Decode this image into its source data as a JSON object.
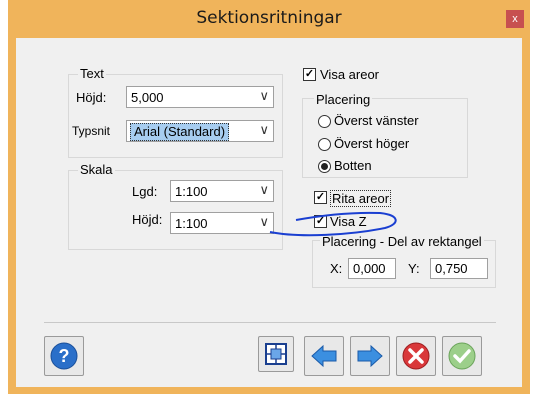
{
  "window": {
    "title": "Sektionsritningar",
    "close_glyph": "x"
  },
  "text_group": {
    "label": "Text",
    "height_label": "Höjd:",
    "height_value": "5,000",
    "font_label": "Typsnit",
    "font_value": "Arial (Standard)"
  },
  "scale_group": {
    "label": "Skala",
    "lgd_label": "Lgd:",
    "lgd_value": "1:100",
    "height_label": "Höjd:",
    "height_value": "1:100"
  },
  "show_areas": {
    "label": "Visa areor",
    "checked": true
  },
  "placement": {
    "label": "Placering",
    "options": [
      "Överst vänster",
      "Överst höger",
      "Botten"
    ],
    "selected": "Botten"
  },
  "draw_areas": {
    "label": "Rita areor",
    "checked": true
  },
  "show_z": {
    "label": "Visa Z",
    "checked": true
  },
  "placement_rect": {
    "label": "Placering - Del av rektangel",
    "x_label": "X:",
    "x_value": "0,000",
    "y_label": "Y:",
    "y_value": "0,750"
  },
  "dropdown_arrow": "∨",
  "check_glyph": "✓",
  "buttons": [
    "help-icon",
    "zoom-extents-icon",
    "back-arrow-icon",
    "forward-arrow-icon",
    "cancel-icon",
    "ok-icon"
  ],
  "colors": {
    "titlebar": "#f0b45b",
    "close": "#c75050",
    "accent_blue": "#2a7fd4",
    "annotation": "#1a3fd1"
  }
}
